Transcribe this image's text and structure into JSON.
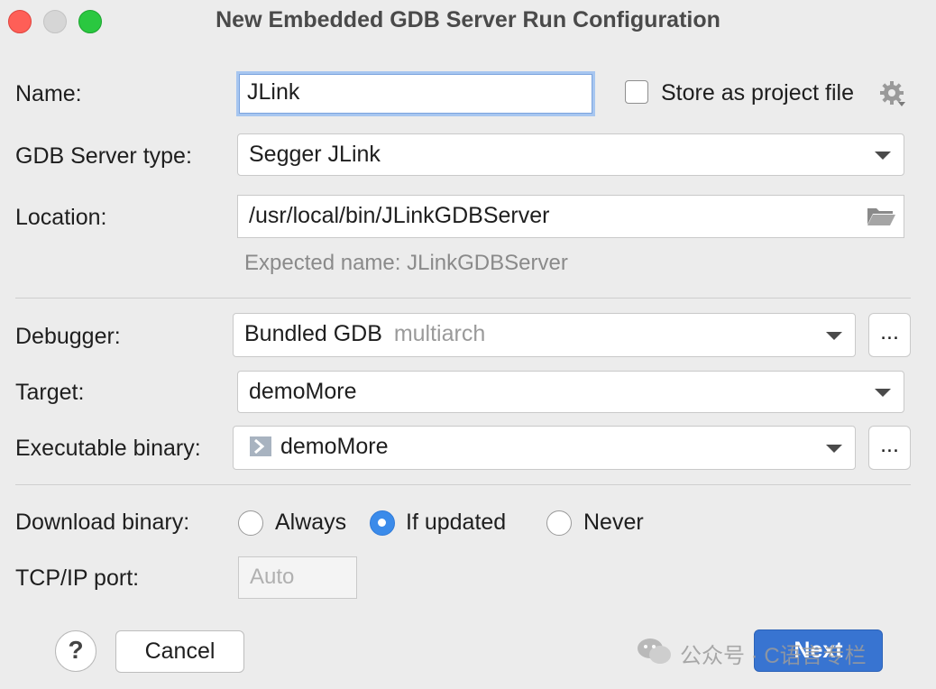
{
  "window": {
    "title": "New Embedded GDB Server Run Configuration"
  },
  "form": {
    "name_label": "Name:",
    "name_value": "JLink",
    "store_label": "Store as project file",
    "store_checked": false,
    "server_type_label": "GDB Server type:",
    "server_type_value": "Segger JLink",
    "location_label": "Location:",
    "location_value": "/usr/local/bin/JLinkGDBServer",
    "location_hint": "Expected name: JLinkGDBServer",
    "debugger_label": "Debugger:",
    "debugger_value": "Bundled GDB",
    "debugger_suffix": "multiarch",
    "debugger_more": "...",
    "target_label": "Target:",
    "target_value": "demoMore",
    "exec_label": "Executable binary:",
    "exec_value": "demoMore",
    "exec_more": "...",
    "download_label": "Download binary:",
    "download_options": [
      "Always",
      "If updated",
      "Never"
    ],
    "download_selected": "If updated",
    "port_label": "TCP/IP port:",
    "port_placeholder": "Auto"
  },
  "footer": {
    "help": "?",
    "cancel": "Cancel",
    "next": "Next"
  },
  "watermark": "公众号 · C语言专栏",
  "icons": [
    "gear-icon",
    "folder-icon",
    "executable-icon",
    "chevron-down-icon",
    "wechat-icon"
  ],
  "colors": {
    "accent": "#3874d1",
    "radio_selected": "#3b8bea",
    "focus_ring": "#a7c6f0"
  }
}
